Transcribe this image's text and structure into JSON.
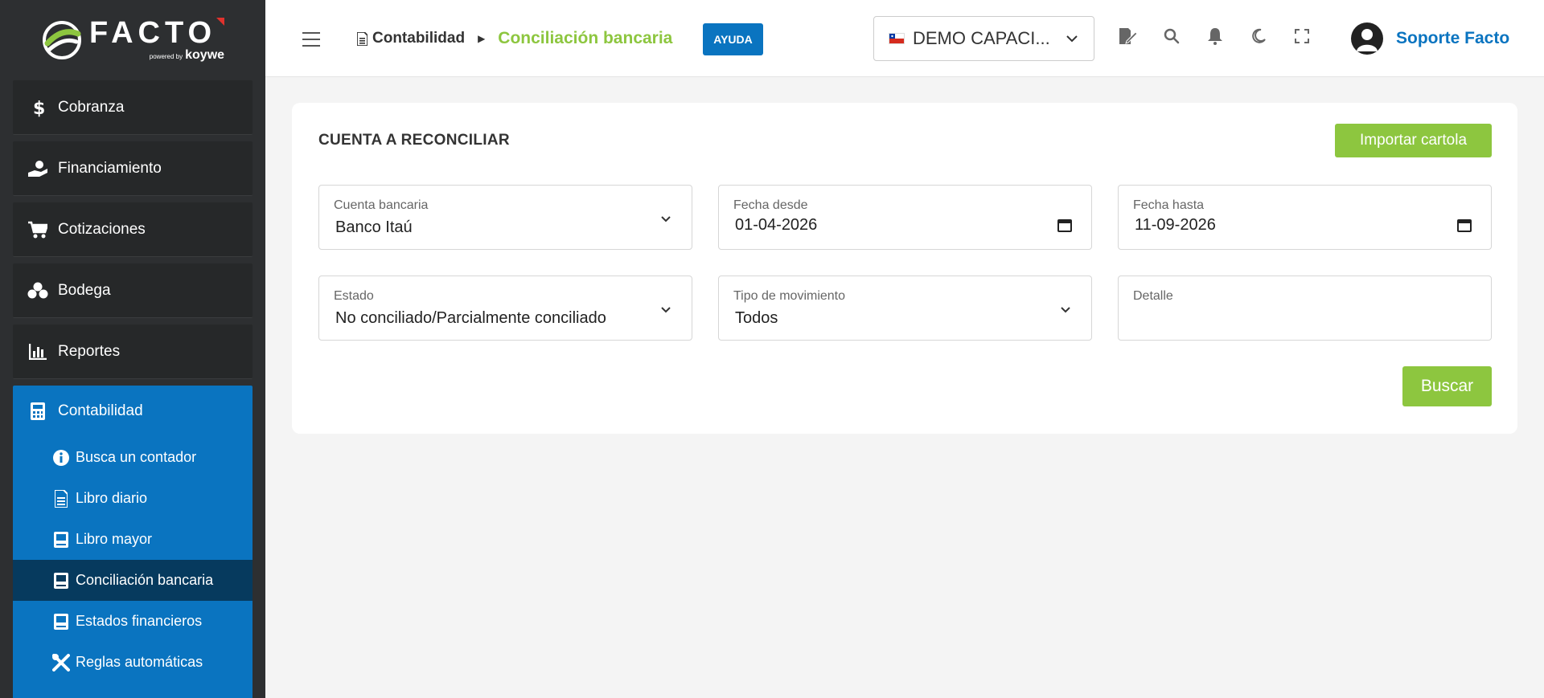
{
  "logo": {
    "word": "FACTO",
    "powered": "powered by",
    "brand": "koywe"
  },
  "sidebar": {
    "items": [
      {
        "label": "Cobranza",
        "icon": "dollar-icon"
      },
      {
        "label": "Financiamiento",
        "icon": "hand-money-icon"
      },
      {
        "label": "Cotizaciones",
        "icon": "cart-icon"
      },
      {
        "label": "Bodega",
        "icon": "boxes-icon"
      },
      {
        "label": "Reportes",
        "icon": "chart-icon"
      }
    ],
    "group": {
      "label": "Contabilidad",
      "icon": "calculator-icon",
      "subitems": [
        {
          "label": "Busca un contador",
          "icon": "info-icon"
        },
        {
          "label": "Libro diario",
          "icon": "document-icon"
        },
        {
          "label": "Libro mayor",
          "icon": "book-icon"
        },
        {
          "label": "Conciliación bancaria",
          "icon": "book-icon",
          "active": true
        },
        {
          "label": "Estados financieros",
          "icon": "book-icon"
        },
        {
          "label": "Reglas automáticas",
          "icon": "tools-icon"
        }
      ]
    }
  },
  "header": {
    "breadcrumb_parent": "Contabilidad",
    "breadcrumb_current": "Conciliación bancaria",
    "help_label": "AYUDA",
    "company": "DEMO CAPACI...",
    "user_name": "Soporte Facto"
  },
  "card": {
    "title": "CUENTA A RECONCILIAR",
    "import_label": "Importar cartola",
    "search_label": "Buscar",
    "fields": {
      "cuenta": {
        "label": "Cuenta bancaria",
        "value": "Banco Itaú"
      },
      "desde": {
        "label": "Fecha desde",
        "value": "01-04-2026"
      },
      "hasta": {
        "label": "Fecha hasta",
        "value": "11-09-2026"
      },
      "estado": {
        "label": "Estado",
        "value": "No conciliado/Parcialmente conciliado"
      },
      "tipo": {
        "label": "Tipo de movimiento",
        "value": "Todos"
      },
      "detalle": {
        "label": "Detalle",
        "value": ""
      }
    }
  },
  "colors": {
    "accent_green": "#8dc63f",
    "accent_blue": "#0a74c0",
    "sidebar_bg": "#2d2f31"
  }
}
